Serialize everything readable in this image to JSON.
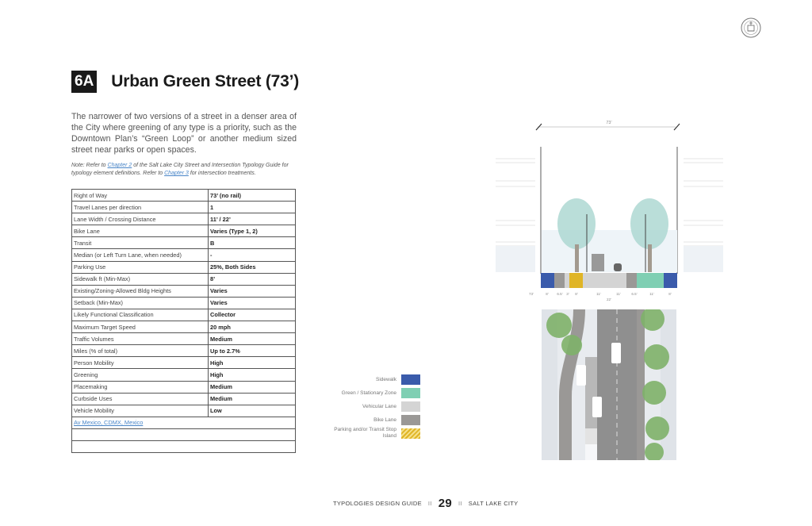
{
  "header": {
    "badge": "6A",
    "title": "Urban Green Street (73’)"
  },
  "description": "The narrower of two versions of a street in a denser area of the City where greening of any type is a priority, such as the Downtown Plan’s “Green Loop” or another medium sized street near parks or open spaces.",
  "note": {
    "prefix": "Note: Refer to ",
    "link1": "Chapter 2",
    "middle": " of the Salt Lake City Street and Intersection Typology Guide for typology element definitions. Refer to ",
    "link2": "Chapter 3",
    "suffix": " for intersection treatments."
  },
  "spec_table": [
    {
      "label": "Right of Way",
      "value": "73’ (no rail)"
    },
    {
      "label": "Travel Lanes per direction",
      "value": "1"
    },
    {
      "label": "Lane Width / Crossing Distance",
      "value": "11’ / 22’"
    },
    {
      "label": "Bike Lane",
      "value": "Varies (Type 1, 2)"
    },
    {
      "label": "Transit",
      "value": "B"
    },
    {
      "label": "Median (or Left Turn Lane, when needed)",
      "value": "-"
    },
    {
      "label": "Parking Use",
      "value": "25%, Both Sides"
    },
    {
      "label": "Sidewalk ft (Min-Max)",
      "value": "8’"
    },
    {
      "label": "Existing/Zoning-Allowed Bldg Heights",
      "value": "Varies"
    },
    {
      "label": "Setback (Min-Max)",
      "value": "Varies"
    },
    {
      "label": "Likely Functional Classification",
      "value": "Collector"
    },
    {
      "label": "Maximum Target Speed",
      "value": "20 mph"
    },
    {
      "label": "Traffic Volumes",
      "value": "Medium"
    },
    {
      "label": "Miles (% of total)",
      "value": "Up to 2.7%"
    },
    {
      "label": "Person Mobility",
      "value": "High"
    },
    {
      "label": "Greening",
      "value": "High"
    },
    {
      "label": "Placemaking",
      "value": "Medium"
    },
    {
      "label": "Curbside Uses",
      "value": "Medium"
    },
    {
      "label": "Vehicle Mobility",
      "value": "Low"
    }
  ],
  "example_link": "Av Mexico, CDMX, Mexico",
  "section": {
    "row_width": "73’",
    "dims": [
      "73’",
      "8’",
      "6.5’",
      "3’",
      "8’",
      "11’",
      "11’",
      "6.5’",
      "11’",
      "8’"
    ],
    "crossing": "22’"
  },
  "legend": [
    {
      "label": "Sidewalk",
      "color": "#3a5bab"
    },
    {
      "label": "Green / Stationary Zone",
      "color": "#7fcfb3"
    },
    {
      "label": "Vehicular Lane",
      "color": "#d4d4d4"
    },
    {
      "label": "Bike Lane",
      "color": "#9a9896"
    },
    {
      "label": "Parking and/or Transit Stop Island",
      "color": "#e0b526"
    }
  ],
  "footer": {
    "left": "TYPOLOGIES DESIGN GUIDE",
    "sep": "II",
    "page": "29",
    "right": "SALT LAKE CITY"
  }
}
